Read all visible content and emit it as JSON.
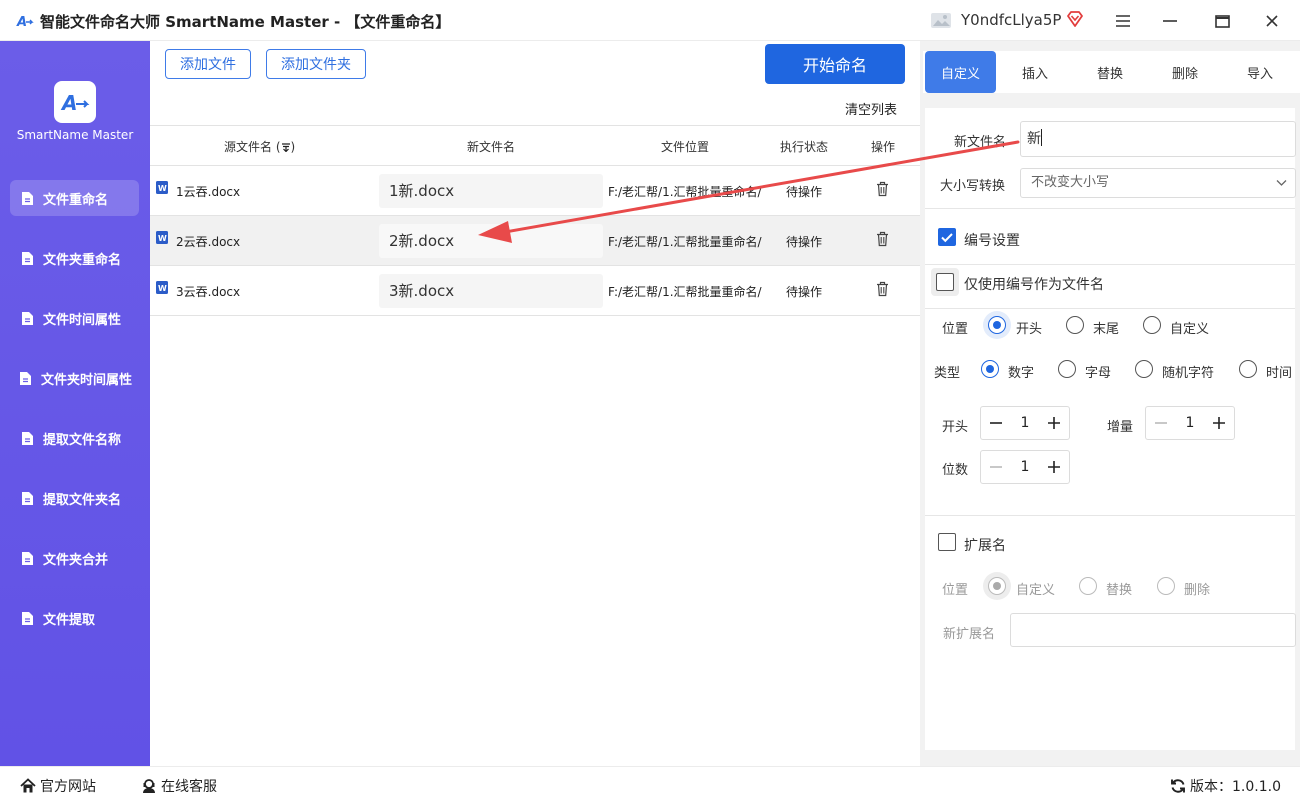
{
  "window": {
    "title": "智能文件命名大师 SmartName Master - 【文件重命名】",
    "user_name": "Y0ndfcLlya5P"
  },
  "sidebar": {
    "logo_text": "SmartName Master",
    "items": [
      {
        "label": "文件重命名"
      },
      {
        "label": "文件夹重命名"
      },
      {
        "label": "文件时间属性"
      },
      {
        "label": "文件夹时间属性"
      },
      {
        "label": "提取文件名称"
      },
      {
        "label": "提取文件夹名"
      },
      {
        "label": "文件夹合并"
      },
      {
        "label": "文件提取"
      }
    ]
  },
  "toolbar": {
    "add_file": "添加文件",
    "add_folder": "添加文件夹",
    "start": "开始命名",
    "clear_list": "清空列表"
  },
  "table": {
    "columns": [
      "源文件名 (",
      "新文件名",
      "文件位置",
      "执行状态",
      "操作"
    ],
    "rows": [
      {
        "source": "1云吞.docx",
        "new_name": "1新.docx",
        "location": "F:/老汇帮/1.汇帮批量重命名/",
        "status": "待操作"
      },
      {
        "source": "2云吞.docx",
        "new_name": "2新.docx",
        "location": "F:/老汇帮/1.汇帮批量重命名/",
        "status": "待操作"
      },
      {
        "source": "3云吞.docx",
        "new_name": "3新.docx",
        "location": "F:/老汇帮/1.汇帮批量重命名/",
        "status": "待操作"
      }
    ]
  },
  "right_panel": {
    "tabs": [
      "自定义",
      "插入",
      "替换",
      "删除",
      "导入"
    ],
    "new_name_label": "新文件名",
    "new_name_value": "新",
    "case_label": "大小写转换",
    "case_value": "不改变大小写",
    "numbering_label": "编号设置",
    "only_number_label": "仅使用编号作为文件名",
    "position_label": "位置",
    "position_options": [
      "开头",
      "末尾",
      "自定义"
    ],
    "type_label": "类型",
    "type_options": [
      "数字",
      "字母",
      "随机字符",
      "时间"
    ],
    "start_label": "开头",
    "start_value": "1",
    "increment_label": "增量",
    "increment_value": "1",
    "digits_label": "位数",
    "digits_value": "1",
    "ext_label": "扩展名",
    "ext_position_label": "位置",
    "ext_position_options": [
      "自定义",
      "替换",
      "删除"
    ],
    "new_ext_label": "新扩展名",
    "new_ext_value": ""
  },
  "statusbar": {
    "website": "官方网站",
    "support": "在线客服",
    "version": "版本：1.0.1.0"
  },
  "colors": {
    "sidebar": "#6b5de8",
    "primary": "#1f66e0",
    "annotation_arrow": "#e84a4a"
  }
}
